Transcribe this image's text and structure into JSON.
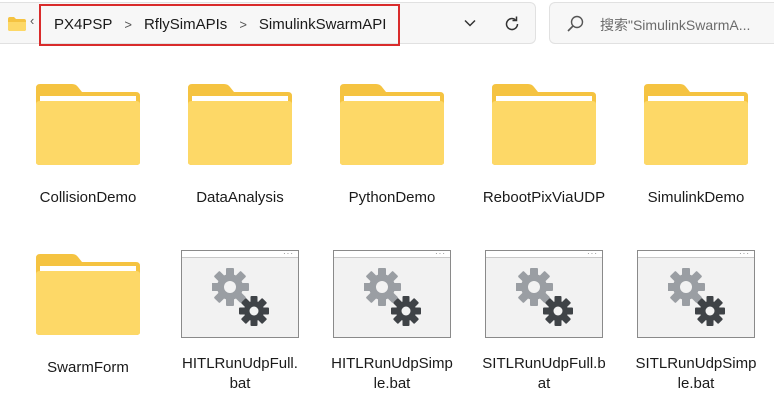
{
  "address_bar": {
    "crumbs": [
      "PX4PSP",
      "RflySimAPIs",
      "SimulinkSwarmAPI"
    ],
    "separator": ">",
    "leading_separator": "‹"
  },
  "search": {
    "placeholder": "搜索\"SimulinkSwarmA..."
  },
  "items": [
    {
      "label": "CollisionDemo",
      "type": "folder"
    },
    {
      "label": "DataAnalysis",
      "type": "folder"
    },
    {
      "label": "PythonDemo",
      "type": "folder"
    },
    {
      "label": "RebootPixViaUDP",
      "type": "folder"
    },
    {
      "label": "SimulinkDemo",
      "type": "folder"
    },
    {
      "label": "SwarmForm",
      "type": "folder"
    },
    {
      "label": "HITLRunUdpFull.bat",
      "type": "bat"
    },
    {
      "label": "HITLRunUdpSimple.bat",
      "type": "bat"
    },
    {
      "label": "SITLRunUdpFull.bat",
      "type": "bat"
    },
    {
      "label": "SITLRunUdpSimple.bat",
      "type": "bat"
    }
  ],
  "colors": {
    "highlight_border": "#d92b2b",
    "folder_back": "#f5c341",
    "folder_front": "#fdd867"
  }
}
